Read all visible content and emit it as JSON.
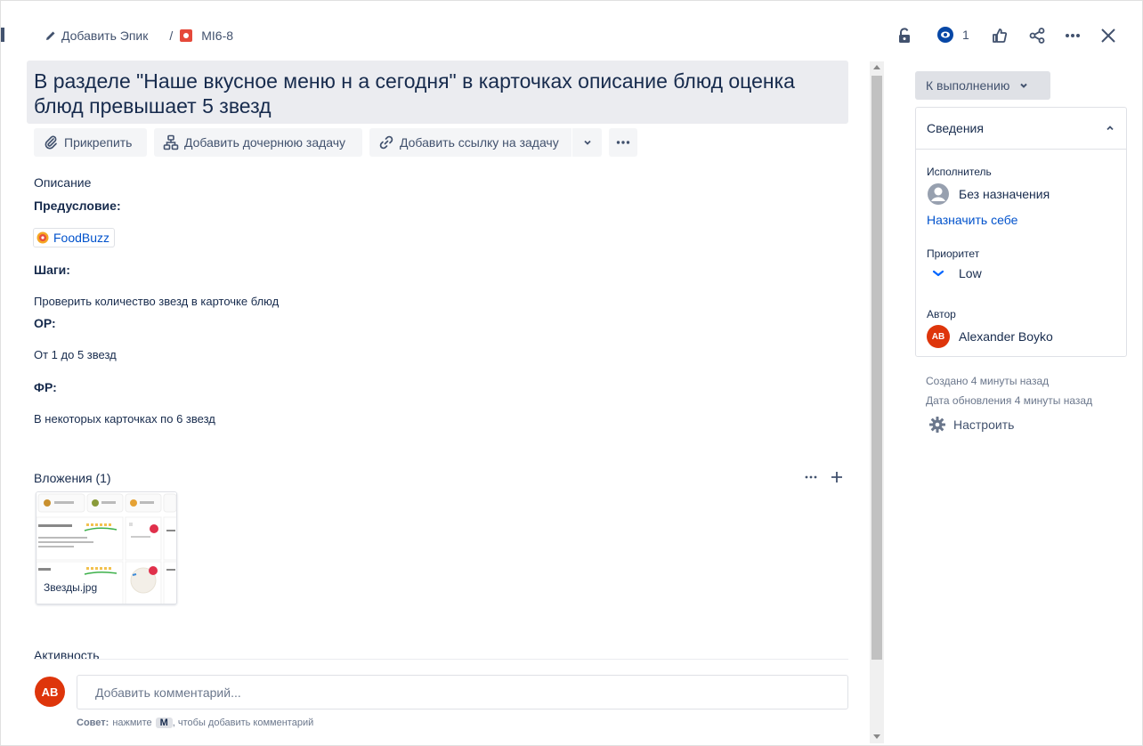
{
  "breadcrumb": {
    "add_epic": "Добавить Эпик",
    "separator": "/",
    "issue_key": "MI6-8"
  },
  "topbar": {
    "watchers_count": "1"
  },
  "issue": {
    "title": "В разделе \"Наше вкусное меню н а сегодня\" в карточках описание блюд оценка блюд превышает 5 звезд"
  },
  "actions": {
    "attach": "Прикрепить",
    "add_child": "Добавить дочернюю задачу",
    "add_link": "Добавить ссылку на задачу"
  },
  "description": {
    "heading": "Описание",
    "precondition_label": "Предусловие:",
    "link_chip": "FoodBuzz",
    "steps_label": "Шаги:",
    "steps_text": "Проверить количество звезд в карточке блюд",
    "expected_label": "ОР:",
    "expected_text": "От 1 до 5 звезд",
    "actual_label": "ФР:",
    "actual_text": "В некоторых карточках по 6 звезд"
  },
  "attachments": {
    "heading": "Вложения (1)",
    "file_name": "Звезды.jpg"
  },
  "activity": {
    "heading": "Активность",
    "comment_avatar": "AB",
    "comment_placeholder": "Добавить комментарий...",
    "tip_prefix": "Совет:",
    "tip_middle": "нажмите",
    "tip_key": "M",
    "tip_suffix": ", чтобы добавить комментарий"
  },
  "sidebar": {
    "status": "К выполнению",
    "details_heading": "Сведения",
    "assignee_label": "Исполнитель",
    "assignee_value": "Без назначения",
    "assign_to_me": "Назначить себе",
    "priority_label": "Приоритет",
    "priority_value": "Low",
    "reporter_label": "Автор",
    "reporter_initials": "AB",
    "reporter_name": "Alexander Boyko",
    "created": "Создано 4 минуты назад",
    "updated": "Дата обновления 4 минуты назад",
    "configure": "Настроить"
  },
  "colors": {
    "accent": "#0052cc",
    "avatar": "#de350b",
    "issue_type": "#e5493a"
  }
}
